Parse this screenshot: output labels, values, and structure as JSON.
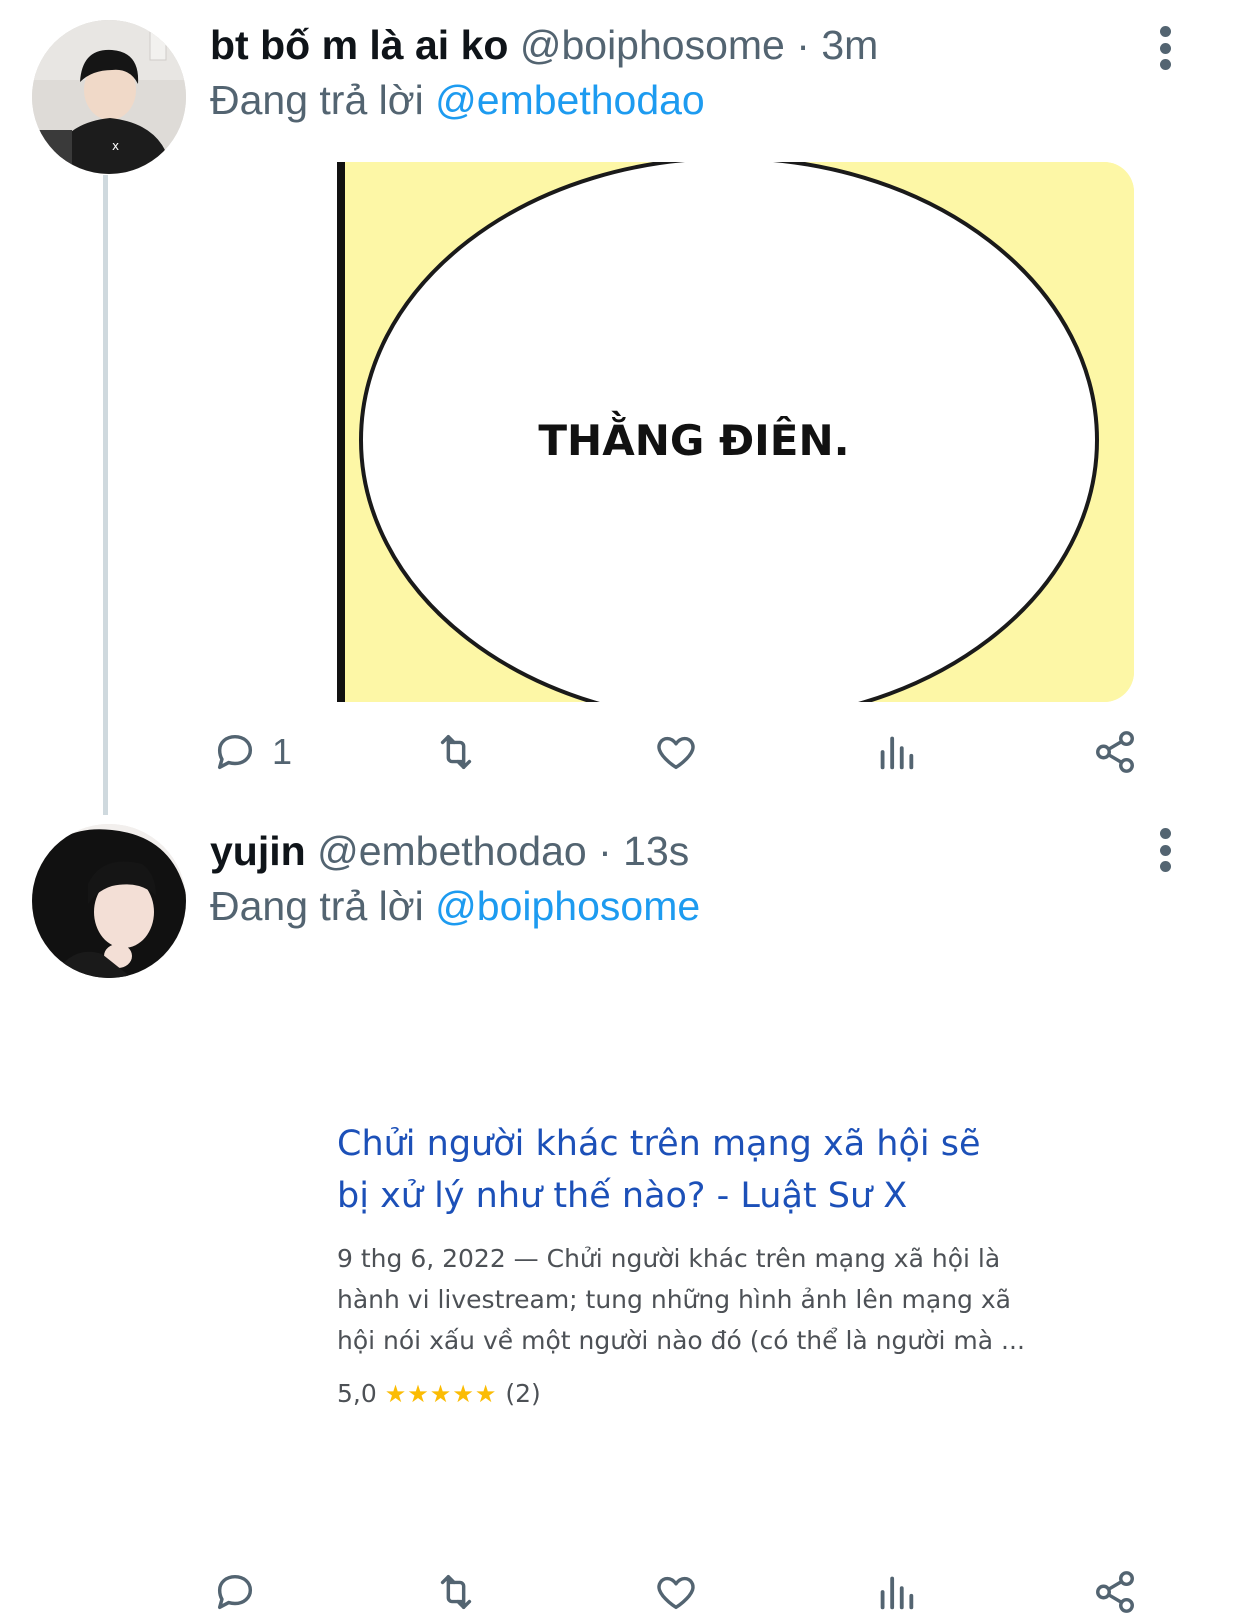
{
  "colors": {
    "text": "#0f1419",
    "secondary": "#536471",
    "link": "#1d9bf0",
    "thread_line": "#cfd9de",
    "media_yellow": "#fdf7a6",
    "result_title": "#1c50b8",
    "stars": "#fbbc04"
  },
  "tweets": [
    {
      "display_name": "bt bố m là ai ko",
      "handle": "@boiphosome",
      "separator": "·",
      "time": "3m",
      "reply_prefix": "Đang trả lời",
      "reply_to": "@embethodao",
      "media": {
        "bubble_text": "THẰNG ĐIÊN."
      },
      "actions": {
        "reply_icon": "reply-icon",
        "reply_count": "1",
        "retweet_icon": "retweet-icon",
        "like_icon": "heart-icon",
        "views_icon": "views-icon",
        "share_icon": "share-icon"
      },
      "more_icon": "more-vertical-icon"
    },
    {
      "display_name": "yujin",
      "handle": "@embethodao",
      "separator": "·",
      "time": "13s",
      "reply_prefix": "Đang trả lời",
      "reply_to": "@boiphosome",
      "search_result": {
        "title_line1": "Chửi người khác trên mạng xã hội sẽ",
        "title_line2": "bị xử lý như thế nào? - Luật Sư X",
        "snippet_line1": "9 thg 6, 2022 — Chửi người khác trên mạng xã hội là",
        "snippet_line2": "hành vi livestream; tung những hình ảnh lên mạng xã",
        "snippet_line3": "hội nói xấu về một người nào đó (có thể là người mà ...",
        "rating_value": "5,0",
        "stars": "★★★★★",
        "rating_count": "(2)"
      },
      "actions": {
        "reply_icon": "reply-icon",
        "retweet_icon": "retweet-icon",
        "like_icon": "heart-icon",
        "views_icon": "views-icon",
        "share_icon": "share-icon"
      },
      "more_icon": "more-vertical-icon"
    }
  ]
}
